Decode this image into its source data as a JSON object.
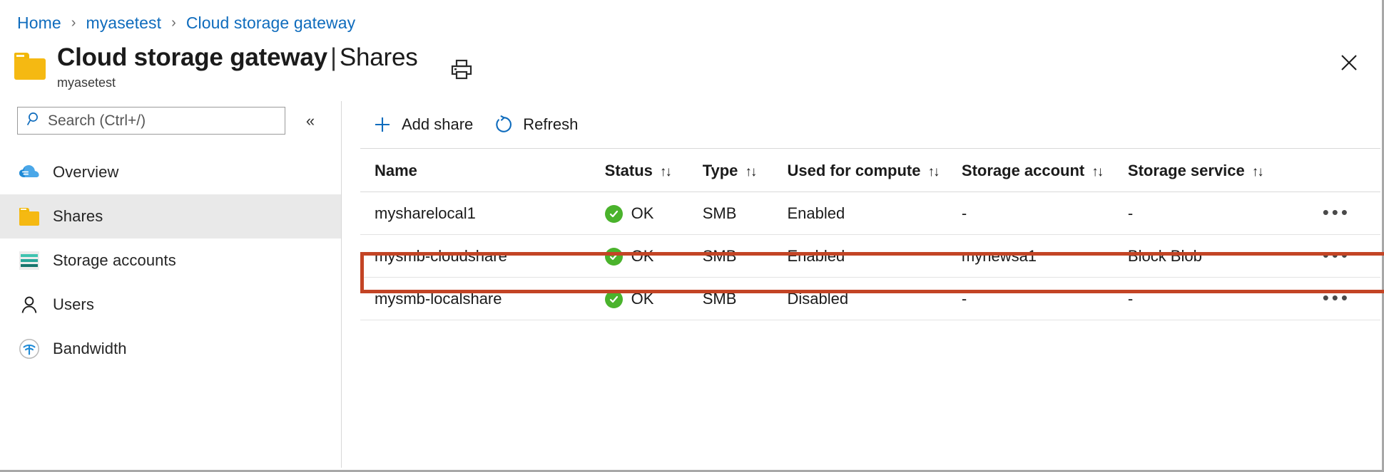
{
  "breadcrumb": {
    "items": [
      {
        "label": "Home"
      },
      {
        "label": "myasetest"
      },
      {
        "label": "Cloud storage gateway"
      }
    ],
    "separator": "›"
  },
  "header": {
    "title": "Cloud storage gateway",
    "title_separator": "|",
    "title_section": "Shares",
    "subtitle": "myasetest",
    "folder_icon": "folder-icon",
    "print_icon": "print-icon",
    "close_icon": "close-icon"
  },
  "sidebar": {
    "search": {
      "placeholder": "Search (Ctrl+/)",
      "value": "",
      "icon": "search-icon"
    },
    "collapse_icon": "«",
    "items": [
      {
        "label": "Overview",
        "icon": "cloud-icon",
        "selected": false
      },
      {
        "label": "Shares",
        "icon": "folder-icon",
        "selected": true
      },
      {
        "label": "Storage accounts",
        "icon": "storage-account-icon",
        "selected": false
      },
      {
        "label": "Users",
        "icon": "person-icon",
        "selected": false
      },
      {
        "label": "Bandwidth",
        "icon": "bandwidth-icon",
        "selected": false
      }
    ]
  },
  "toolbar": {
    "buttons": [
      {
        "label": "Add share",
        "icon": "plus-icon"
      },
      {
        "label": "Refresh",
        "icon": "refresh-icon"
      }
    ]
  },
  "table": {
    "sort_glyph": "↑↓",
    "columns": [
      {
        "key": "name",
        "label": "Name",
        "sortable": true
      },
      {
        "key": "status",
        "label": "Status",
        "sortable": true
      },
      {
        "key": "type",
        "label": "Type",
        "sortable": true
      },
      {
        "key": "compute",
        "label": "Used for compute",
        "sortable": true
      },
      {
        "key": "account",
        "label": "Storage account",
        "sortable": true
      },
      {
        "key": "service",
        "label": "Storage service",
        "sortable": true
      },
      {
        "key": "menu",
        "label": "",
        "sortable": false
      }
    ],
    "rows": [
      {
        "name": "mysharelocal1",
        "status": "OK",
        "type": "SMB",
        "compute": "Enabled",
        "account": "-",
        "service": "-",
        "menu": "•••",
        "highlighted": false
      },
      {
        "name": "mysmb-cloudshare",
        "status": "OK",
        "type": "SMB",
        "compute": "Enabled",
        "account": "mynewsa1",
        "service": "Block Blob",
        "menu": "•••",
        "highlighted": true
      },
      {
        "name": "mysmb-localshare",
        "status": "OK",
        "type": "SMB",
        "compute": "Disabled",
        "account": "-",
        "service": "-",
        "menu": "•••",
        "highlighted": false
      }
    ]
  },
  "colors": {
    "link": "#0f6cbd",
    "accent_blue": "#0f6cbd",
    "status_ok_green": "#4ab32c",
    "highlight_red": "#c34425",
    "folder_yellow": "#f5b912",
    "selected_row_bg": "#e9e9e9"
  }
}
